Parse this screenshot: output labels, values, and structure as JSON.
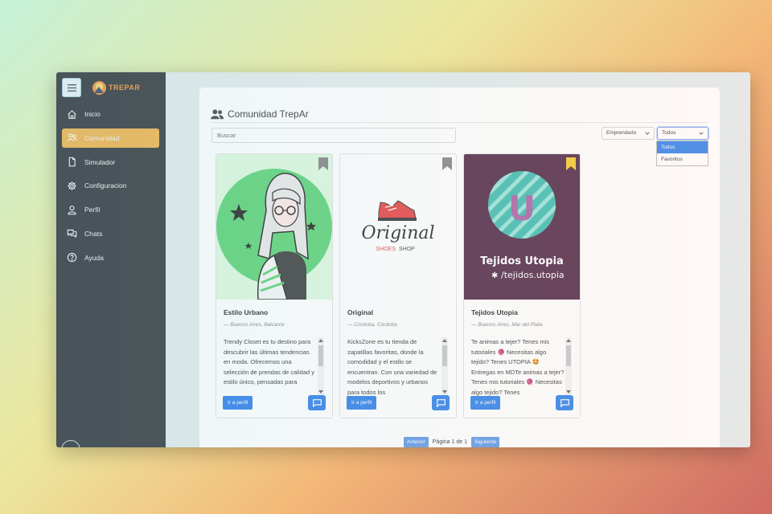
{
  "app": {
    "logo_text": "TREPAR"
  },
  "sidebar": {
    "items": [
      {
        "label": "Inicio",
        "icon": "home-icon"
      },
      {
        "label": "Comunidad",
        "icon": "users-icon",
        "active": true
      },
      {
        "label": "Simulador",
        "icon": "file-icon"
      },
      {
        "label": "Configuracion",
        "icon": "gear-icon"
      },
      {
        "label": "Perfil",
        "icon": "user-icon"
      },
      {
        "label": "Chats",
        "icon": "chats-icon"
      },
      {
        "label": "Ayuda",
        "icon": "help-icon"
      }
    ]
  },
  "main": {
    "title": "Comunidad TrepAr",
    "search_placeholder": "Buscar",
    "category_select": "Emprendedo",
    "favorites_select": "Todos",
    "dropdown_options": [
      "Todos",
      "Favoritos"
    ],
    "dropdown_selected": "Todos"
  },
  "cards": [
    {
      "name": "Estilo Urbano",
      "location": "— Buenos Aires, Balcarce",
      "description": "Trendy Closet es tu destino para descubrir las últimas tendencias en moda. Ofrecemos una selección de prendas de calidad y estilo único, pensadas para",
      "button_label": "Ir a perfil",
      "bookmarked": false
    },
    {
      "name": "Original",
      "location": "— Córdoba, Córdoba",
      "description": "KicksZone es tu tienda de zapatillas favoritas, donde la comodidad y el estilo se encuentran. Con una variedad de modelos deportivos y urbanos para todos los",
      "button_label": "Ir a perfil",
      "bookmarked": false,
      "logo_title": "Original",
      "logo_sub1": "SHOES",
      "logo_sub2": "SHOP"
    },
    {
      "name": "Tejidos Utopia",
      "location": "— Buenos Aires, Mar del Plata",
      "description": "Te animas a tejer? Tenes mis tutoriales 🧶 Necesitas algo tejido? Tenes UTOPIA 🤩 Entregas en MDTe animas a tejer? Tenes mis tutoriales 🧶 Necesitas algo tejido? Tenes",
      "button_label": "Ir a perfil",
      "bookmarked": true,
      "logo_title": "Tejidos Utopia",
      "logo_handle": "/tejidos.utopia",
      "logo_letter": "U"
    }
  ],
  "pagination": {
    "prev": "Anterior",
    "info": "Página 1 de 1",
    "next": "Siguiente"
  },
  "colors": {
    "accent": "#f0ad3e",
    "primary": "#1a73e8",
    "sidebar": "#23272b",
    "bookmark_active": "#f5c518"
  }
}
